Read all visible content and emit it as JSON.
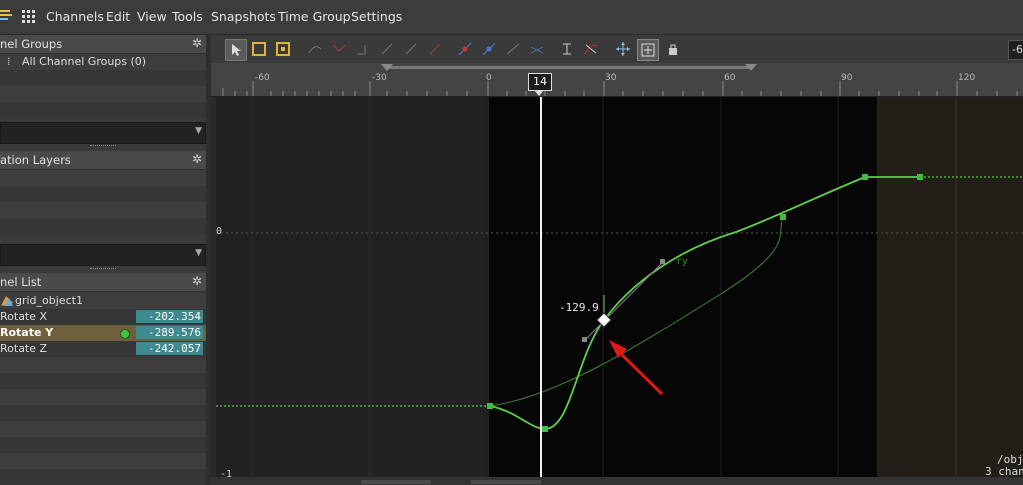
{
  "menubar": {
    "items": [
      "Channels",
      "Edit",
      "View",
      "Tools",
      "Snapshots",
      "Time Group",
      "Settings"
    ]
  },
  "panels": {
    "channel_groups": {
      "title": "nel Groups",
      "items": [
        "All Channel Groups (0)"
      ]
    },
    "animation_layers": {
      "title": "ation Layers"
    },
    "channel_list": {
      "title": "nel List",
      "object": "grid_object1",
      "channels": [
        {
          "name": "Rotate X",
          "value": "-202.354",
          "selected": false
        },
        {
          "name": "Rotate Y",
          "value": "-289.576",
          "selected": true
        },
        {
          "name": "Rotate Z",
          "value": "-242.057",
          "selected": false
        }
      ]
    }
  },
  "toolbar": {
    "right_field": "-6"
  },
  "ruler": {
    "ticks": [
      "-60",
      "-30",
      "0",
      "30",
      "60",
      "90",
      "120"
    ],
    "current_frame": "14"
  },
  "graph": {
    "value_zero_label": "0",
    "value_minus_label": "-1",
    "key_value_label": "-129.9",
    "channel_tag": "ry",
    "path_line1": "/obj",
    "path_line2": "3 chan"
  },
  "colors": {
    "curve": "#5fd04a",
    "selected_row": "#6f5f3d",
    "value_field": "#3e8a8f",
    "arrow": "#e01818"
  }
}
